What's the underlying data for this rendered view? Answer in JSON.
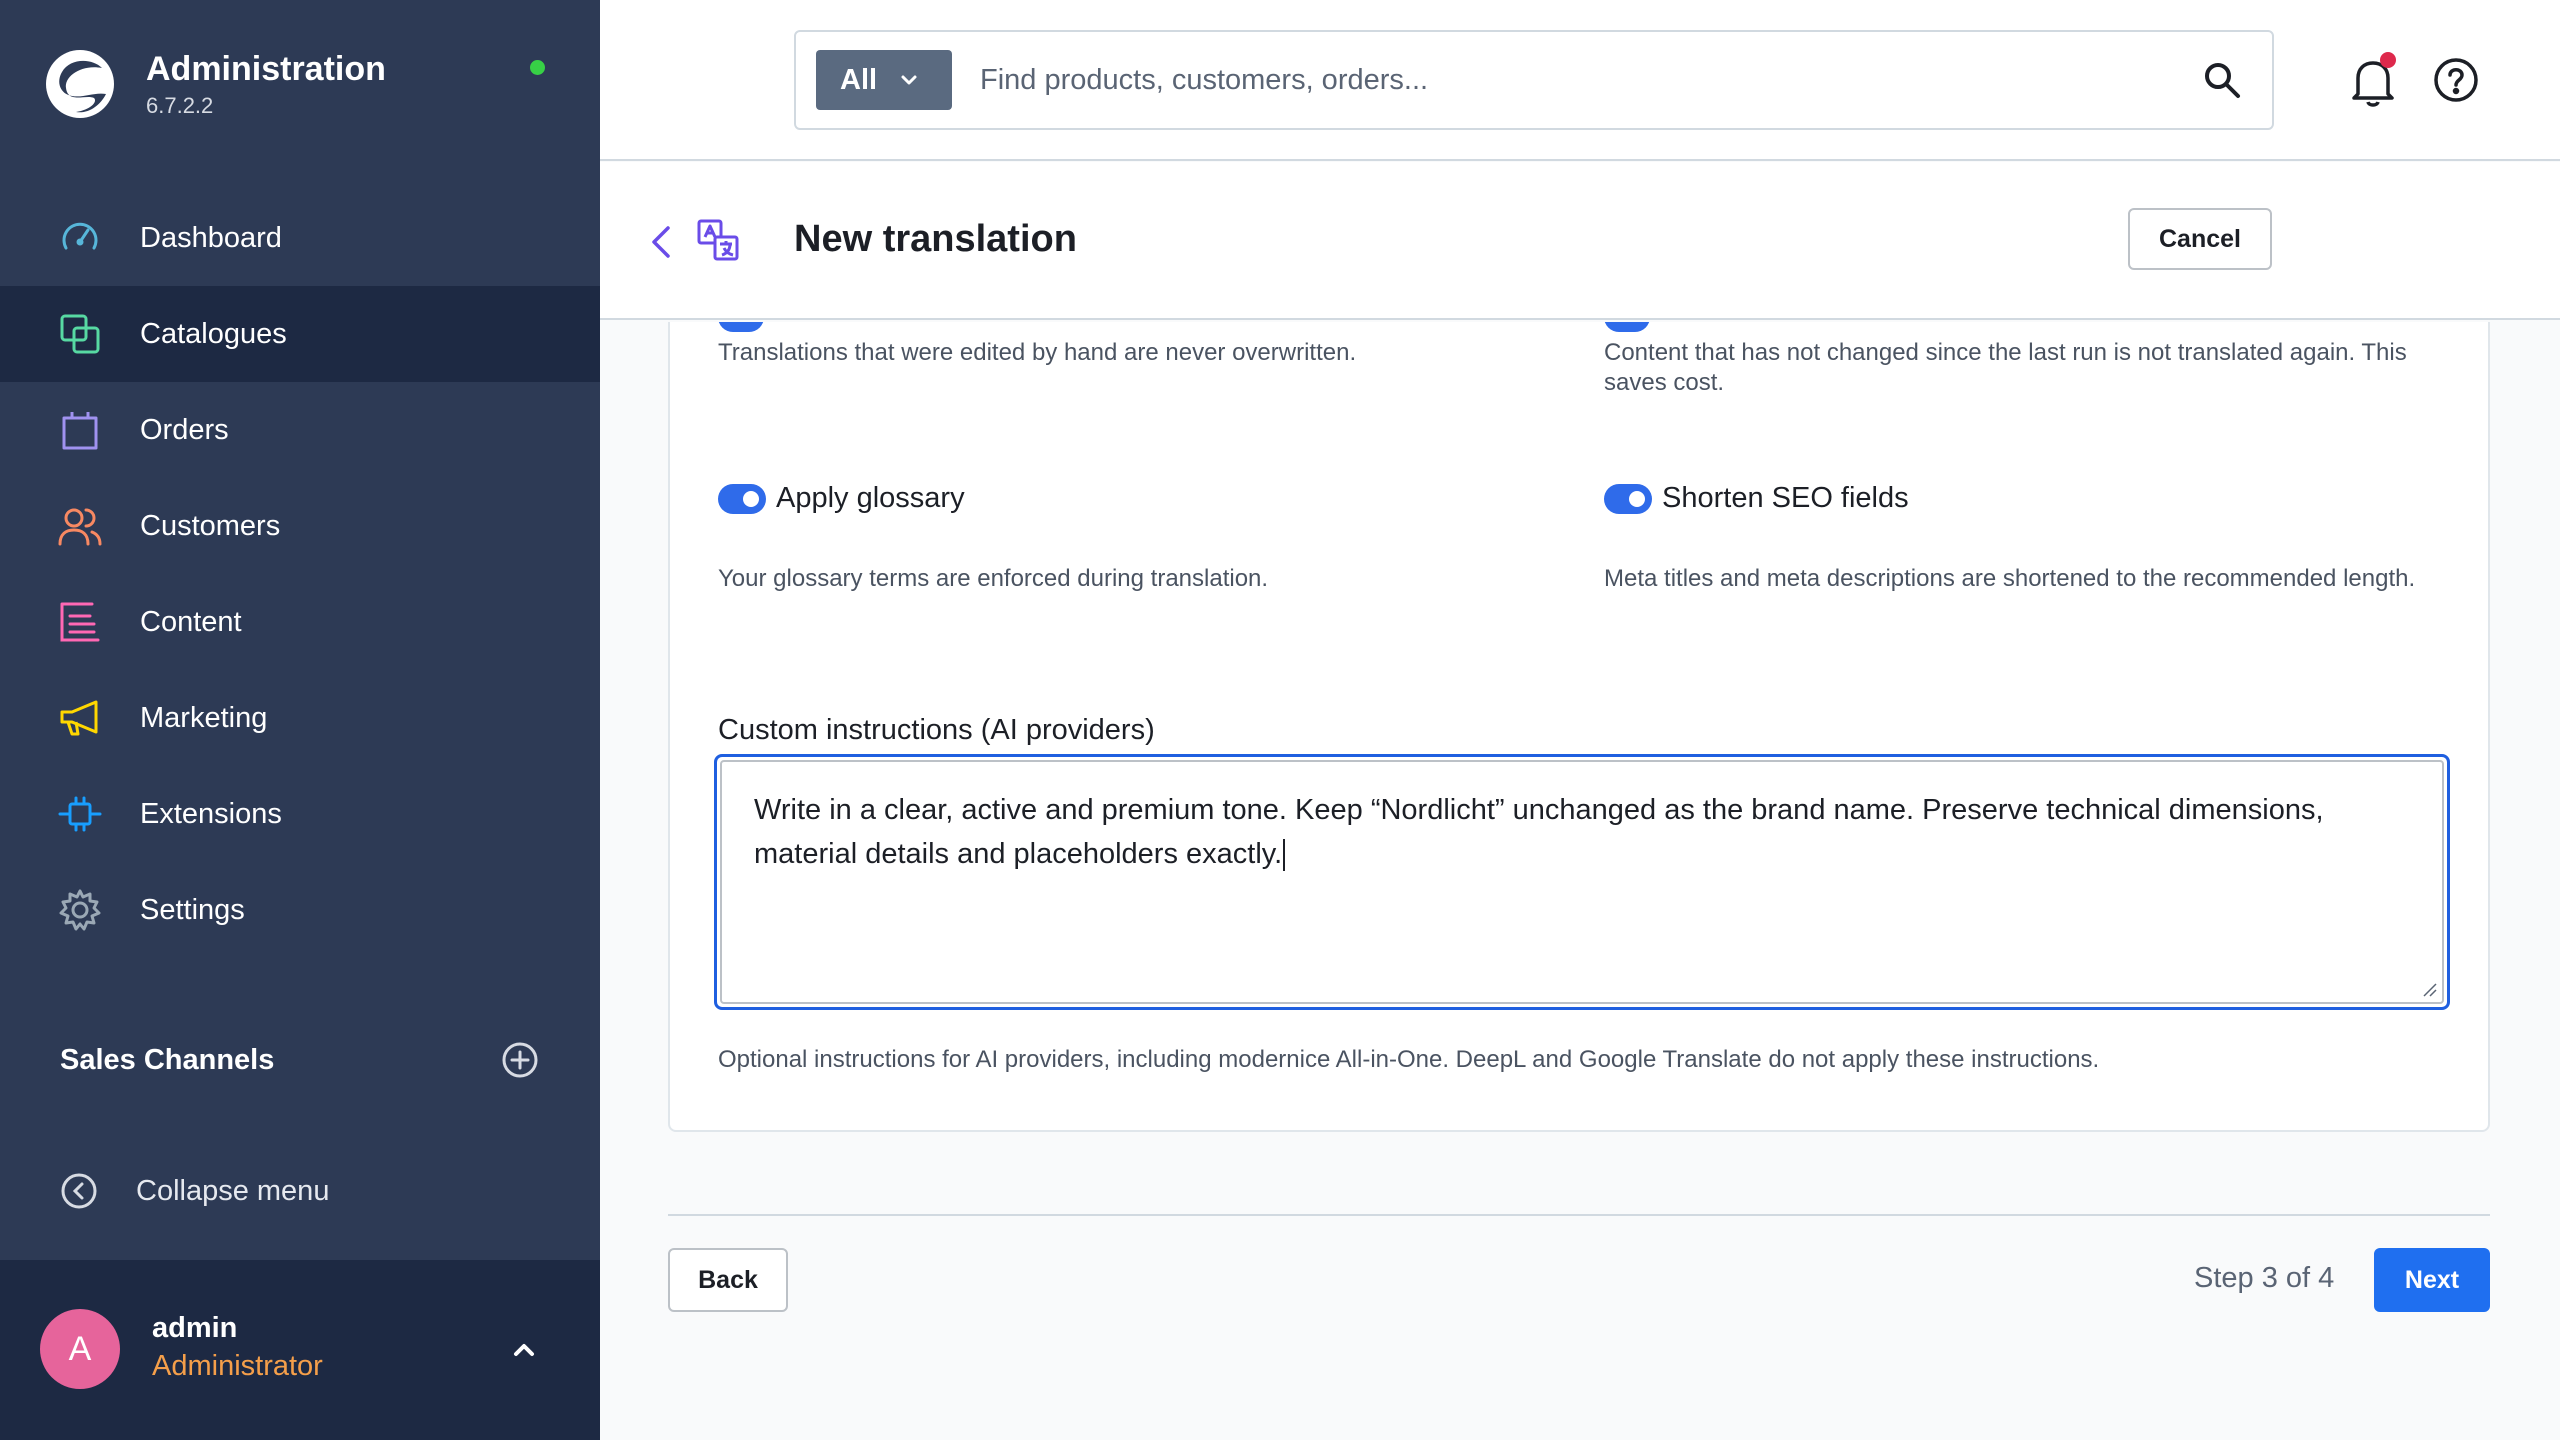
{
  "app": {
    "title": "Administration",
    "version": "6.7.2.2",
    "status_color": "#37d046"
  },
  "sidebar": {
    "items": [
      {
        "label": "Dashboard",
        "icon": "gauge-icon",
        "color": "#57b6d9"
      },
      {
        "label": "Catalogues",
        "icon": "catalogue-icon",
        "color": "#57d9a3",
        "active": true
      },
      {
        "label": "Orders",
        "icon": "shopping-bag-icon",
        "color": "#a092f0"
      },
      {
        "label": "Customers",
        "icon": "users-icon",
        "color": "#f88962"
      },
      {
        "label": "Content",
        "icon": "content-icon",
        "color": "#ff68b4"
      },
      {
        "label": "Marketing",
        "icon": "megaphone-icon",
        "color": "#ffd700"
      },
      {
        "label": "Extensions",
        "icon": "plug-icon",
        "color": "#189eff"
      },
      {
        "label": "Settings",
        "icon": "gear-icon",
        "color": "#9aa8b5"
      }
    ],
    "sales_channels": "Sales Channels",
    "collapse": "Collapse menu",
    "user": {
      "initial": "A",
      "name": "admin",
      "role": "Administrator"
    }
  },
  "topbar": {
    "filter": "All",
    "search_placeholder": "Find products, customers, orders..."
  },
  "header": {
    "title": "New translation",
    "cancel": "Cancel"
  },
  "options": {
    "left_top_desc": "Translations that were edited by hand are never overwritten.",
    "right_top_desc": "Content that has not changed since the last run is not translated again. This saves cost.",
    "glossary_label": "Apply glossary",
    "glossary_desc": "Your glossary terms are enforced during translation.",
    "seo_label": "Shorten SEO fields",
    "seo_desc": "Meta titles and meta descriptions are shortened to the recommended length."
  },
  "custom": {
    "label": "Custom instructions (AI providers)",
    "value": "Write in a clear, active and premium tone. Keep “Nordlicht” unchanged as the brand name. Preserve technical dimensions, material details and placeholders exactly.",
    "help": "Optional instructions for AI providers, including modernice All-in-One. DeepL and Google Translate do not apply these instructions."
  },
  "footer": {
    "back": "Back",
    "step": "Step 3 of 4",
    "next": "Next"
  }
}
